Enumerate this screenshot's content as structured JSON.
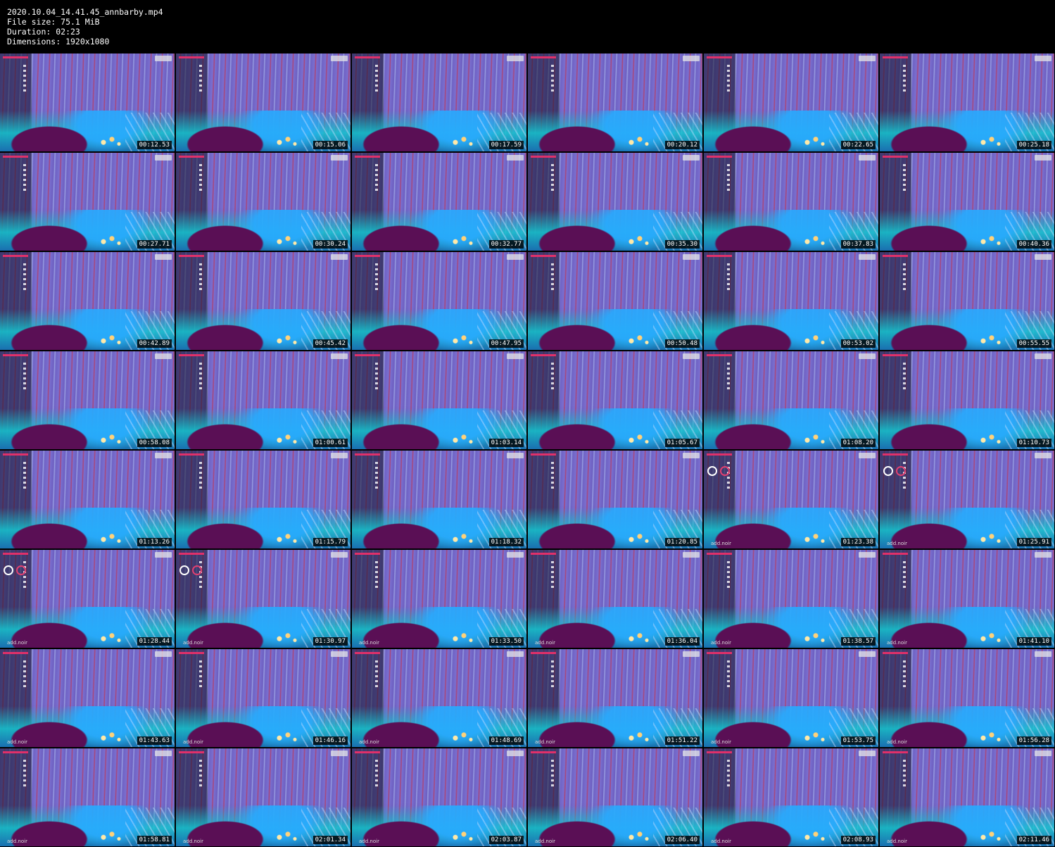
{
  "header": {
    "filename": "2020.10.04_14.41.45_annbarby.mp4",
    "file_size": "File size: 75.1 MiB",
    "duration": "Duration: 02:23",
    "dimensions": "Dimensions: 1920x1080"
  },
  "thumbnails": [
    {
      "timestamp": "00:12.53"
    },
    {
      "timestamp": "00:15.06"
    },
    {
      "timestamp": "00:17.59"
    },
    {
      "timestamp": "00:20.12"
    },
    {
      "timestamp": "00:22.65"
    },
    {
      "timestamp": "00:25.18"
    },
    {
      "timestamp": "00:27.71"
    },
    {
      "timestamp": "00:30.24"
    },
    {
      "timestamp": "00:32.77"
    },
    {
      "timestamp": "00:35.30"
    },
    {
      "timestamp": "00:37.83"
    },
    {
      "timestamp": "00:40.36"
    },
    {
      "timestamp": "00:42.89"
    },
    {
      "timestamp": "00:45.42"
    },
    {
      "timestamp": "00:47.95"
    },
    {
      "timestamp": "00:50.48"
    },
    {
      "timestamp": "00:53.02"
    },
    {
      "timestamp": "00:55.55"
    },
    {
      "timestamp": "00:58.08"
    },
    {
      "timestamp": "01:00.61"
    },
    {
      "timestamp": "01:03.14"
    },
    {
      "timestamp": "01:05.67"
    },
    {
      "timestamp": "01:08.20"
    },
    {
      "timestamp": "01:10.73"
    },
    {
      "timestamp": "01:13.26"
    },
    {
      "timestamp": "01:15.79"
    },
    {
      "timestamp": "01:18.32"
    },
    {
      "timestamp": "01:20.85"
    },
    {
      "timestamp": "01:23.38",
      "circles": true,
      "add_text": "add.noir"
    },
    {
      "timestamp": "01:25.91",
      "circles": true,
      "add_text": "add.noir"
    },
    {
      "timestamp": "01:28.44",
      "circles": true,
      "add_text": "add.noir"
    },
    {
      "timestamp": "01:30.97",
      "circles": true,
      "add_text": "add.noir"
    },
    {
      "timestamp": "01:33.50",
      "add_text": "add.noir"
    },
    {
      "timestamp": "01:36.04",
      "add_text": "add.noir"
    },
    {
      "timestamp": "01:38.57",
      "add_text": "add.noir"
    },
    {
      "timestamp": "01:41.10",
      "add_text": "add.noir"
    },
    {
      "timestamp": "01:43.63",
      "add_text": "add.noir"
    },
    {
      "timestamp": "01:46.16",
      "add_text": "add.noir"
    },
    {
      "timestamp": "01:48.69",
      "add_text": "add.noir"
    },
    {
      "timestamp": "01:51.22",
      "add_text": "add.noir"
    },
    {
      "timestamp": "01:53.75",
      "add_text": "add.noir"
    },
    {
      "timestamp": "01:56.28",
      "add_text": "add.noir"
    },
    {
      "timestamp": "01:58.81",
      "add_text": "add.noir"
    },
    {
      "timestamp": "02:01.34",
      "add_text": "add.noir"
    },
    {
      "timestamp": "02:03.87",
      "add_text": "add.noir"
    },
    {
      "timestamp": "02:06.40",
      "add_text": "add.noir"
    },
    {
      "timestamp": "02:08.93",
      "add_text": "add.noir"
    },
    {
      "timestamp": "02:11.46",
      "add_text": "add.noir"
    }
  ]
}
